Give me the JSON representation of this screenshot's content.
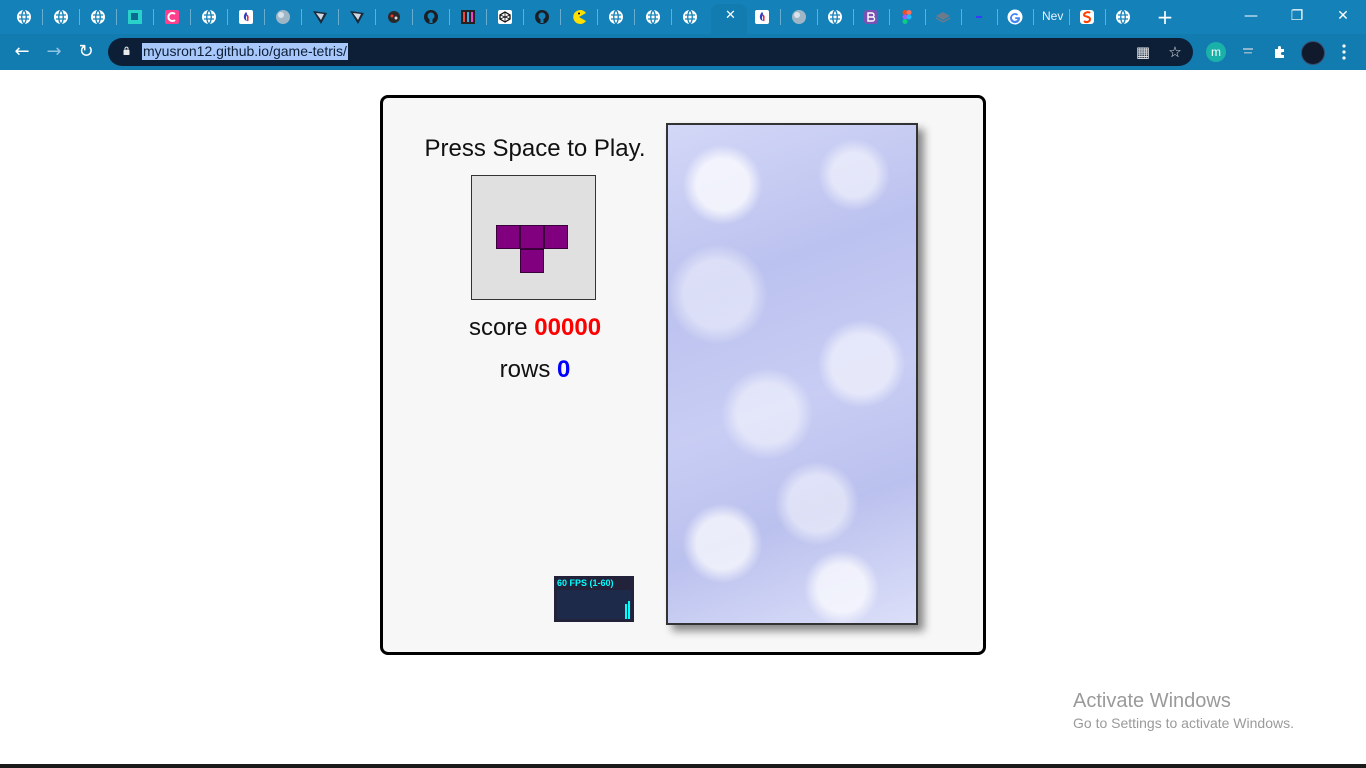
{
  "browser": {
    "tab_close_glyph": "✕",
    "tab_text_new": "Nev",
    "new_tab_glyph": "+",
    "window": {
      "minimize": "—",
      "restore": "❐",
      "close": "✕"
    },
    "nav": {
      "back": "←",
      "forward": "→",
      "reload": "↻"
    },
    "url": "myusron12.github.io/game-tetris/",
    "omnibox_icons": {
      "qr": "▦",
      "bookmark": "☆"
    },
    "extensions": {
      "m_badge": "m"
    },
    "colors": {
      "tabstrip": "#1481b8",
      "toolbar": "#127bb0",
      "omnibox": "#0d1f36"
    }
  },
  "game": {
    "menu_text": "Press Space to Play.",
    "score_label": "score",
    "score_value": "00000",
    "rows_label": "rows",
    "rows_value": "0",
    "fps_text": "60 FPS (1-60)",
    "next_piece": "T",
    "next_piece_color": "#800080"
  },
  "watermark": {
    "title": "Activate Windows",
    "subtitle": "Go to Settings to activate Windows."
  }
}
